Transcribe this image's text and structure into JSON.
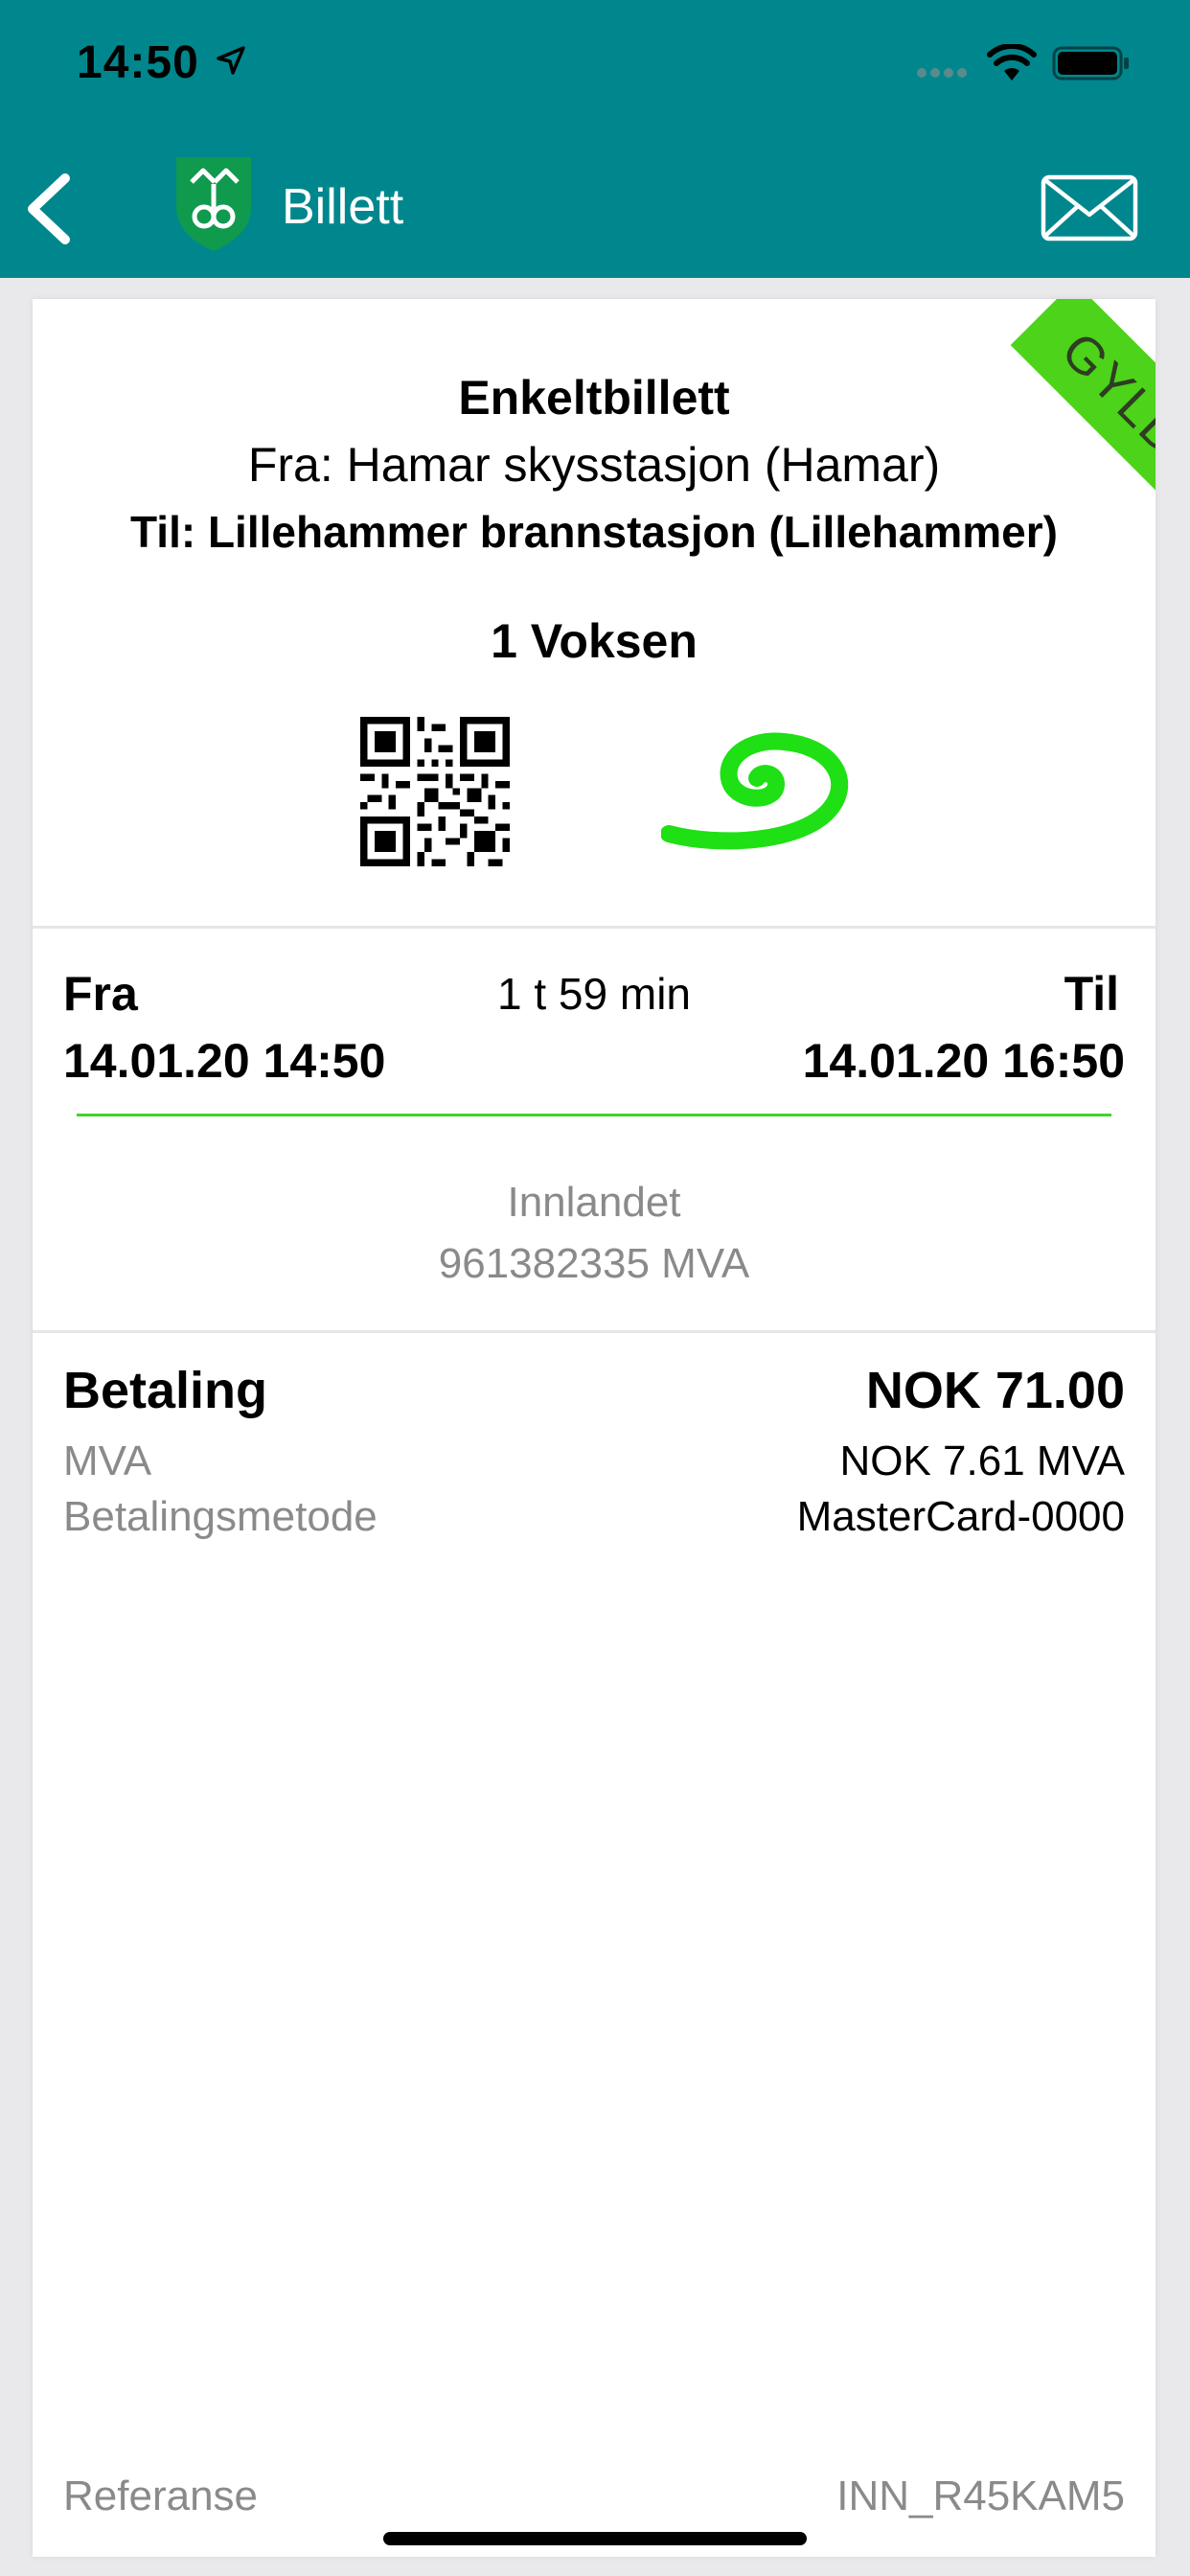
{
  "status_bar": {
    "time": "14:50"
  },
  "header": {
    "title": "Billett",
    "accent_color": "#00878d",
    "icons": [
      "chevron-left-icon",
      "shield-logo",
      "envelope-icon"
    ]
  },
  "ticket": {
    "status_badge": "GYLDIG",
    "status_color": "#4cd31a",
    "type": "Enkeltbillett",
    "from": "Fra: Hamar skysstasjon (Hamar)",
    "to": "Til: Lillehammer brannstasjon (Lillehammer)",
    "travellers": "1 Voksen"
  },
  "trip": {
    "from_label": "Fra",
    "to_label": "Til",
    "duration": "1 t 59 min",
    "from_time": "14.01.20 14:50",
    "to_time": "14.01.20 16:50",
    "operator": "Innlandet",
    "org_number": "961382335 MVA"
  },
  "payment": {
    "label": "Betaling",
    "amount": "NOK 71.00",
    "mva_label": "MVA",
    "mva_value": "NOK 7.61 MVA",
    "method_label": "Betalingsmetode",
    "method_value": "MasterCard-0000"
  },
  "reference": {
    "label": "Referanse",
    "value": "INN_R45KAM5"
  }
}
